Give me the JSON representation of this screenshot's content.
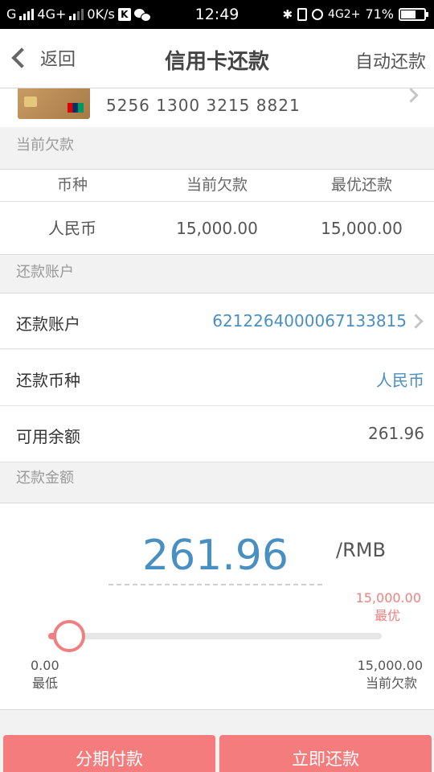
{
  "status_bar": {
    "carrier": "G",
    "network1": "4G+",
    "speed": "0K/s",
    "k_icon": "K",
    "time": "12:49",
    "network2": "4G2+",
    "battery": "71%",
    "battery_level": 0.71
  },
  "nav": {
    "back_label": "返回",
    "title": "信用卡还款",
    "right_label": "自动还款"
  },
  "card": {
    "number": "5256 1300 3215 8821"
  },
  "debt_section": {
    "header": "当前欠款",
    "columns": [
      "币种",
      "当前欠款",
      "最优还款"
    ],
    "rows": [
      [
        "人民币",
        "15,000.00",
        "15,000.00"
      ]
    ]
  },
  "account_section": {
    "header": "还款账户",
    "items": [
      {
        "label": "还款账户",
        "value": "6212264000067133815"
      },
      {
        "label": "还款币种",
        "value": "人民币"
      },
      {
        "label": "可用余额",
        "value": "261.96"
      }
    ]
  },
  "amount_section": {
    "header": "还款金额",
    "amount": "261.96",
    "unit": "/RMB",
    "best_value": "15,000.00",
    "best_label": "最优",
    "min_value": "0.00",
    "min_label": "最低",
    "max_value": "15,000.00",
    "max_label": "当前欠款",
    "slider_fraction": 0.017
  },
  "buttons": {
    "installment": "分期付款",
    "pay_now": "立即还款"
  },
  "colors": {
    "accent": "#4a8fc2",
    "button": "#f47c7c",
    "highlight": "#f08080"
  }
}
